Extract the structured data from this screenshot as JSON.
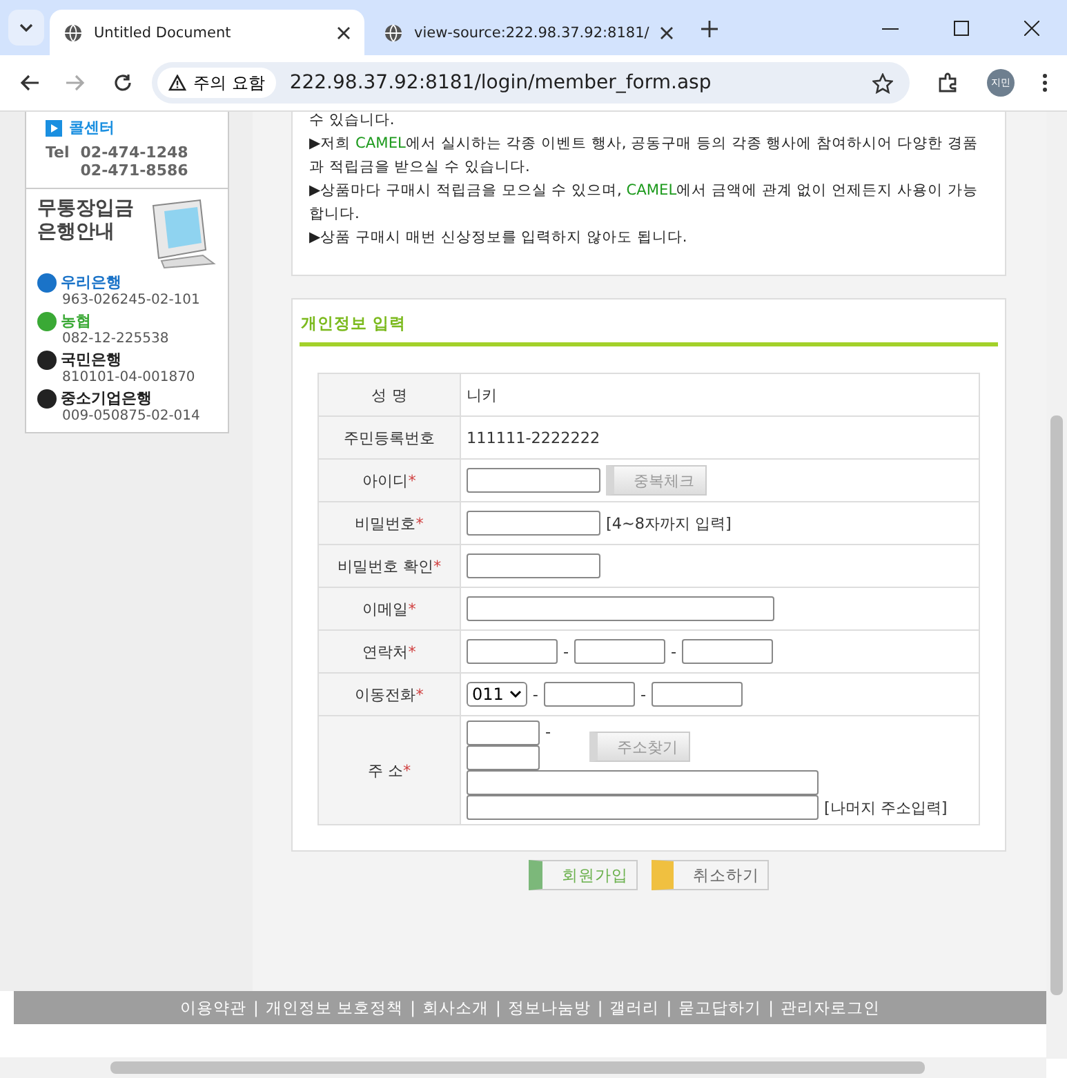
{
  "browser": {
    "tabs": [
      {
        "title": "Untitled Document",
        "selected": true
      },
      {
        "title": "view-source:222.98.37.92:8181/",
        "selected": false
      }
    ],
    "address": {
      "warning": "주의 요함",
      "url": "222.98.37.92:8181/login/member_form.asp"
    },
    "profile": "지민"
  },
  "sidebar": {
    "call_center": {
      "label": "콜센터",
      "tel_label": "Tel",
      "numbers": [
        "02-474-1248",
        "02-471-8586"
      ]
    },
    "bank_info": {
      "title_lines": [
        "무통장입금",
        "은행안내"
      ],
      "banks": [
        {
          "name": "우리은행",
          "account": "963-026245-02-101",
          "color": "#1a73c8"
        },
        {
          "name": "농협",
          "account": "082-12-225538",
          "color": "#3aa935"
        },
        {
          "name": "국민은행",
          "account": "810101-04-001870",
          "color": "#222222"
        },
        {
          "name": "중소기업은행",
          "account": "009-050875-02-014",
          "color": "#222222"
        }
      ]
    }
  },
  "benefits": [
    {
      "kind": "continuation",
      "parts": [
        {
          "text": "수 있습니다.",
          "brand": false
        }
      ]
    },
    {
      "kind": "bullet",
      "marker": "▶",
      "parts": [
        {
          "text": "저희 ",
          "brand": false
        },
        {
          "text": "CAMEL",
          "brand": true
        },
        {
          "text": "에서 실시하는 각종 이벤트 행사, 공동구매 등의 각종 행사에 참여하시어 다양한 경품과 적립금을 받으실 수 있습니다.",
          "brand": false
        }
      ]
    },
    {
      "kind": "bullet",
      "marker": "▶",
      "parts": [
        {
          "text": "상품마다 구매시 적립금을 모으실 수 있으며, ",
          "brand": false
        },
        {
          "text": "CAMEL",
          "brand": true
        },
        {
          "text": "에서 금액에 관계 없이 언제든지 사용이 가능합니다.",
          "brand": false
        }
      ]
    },
    {
      "kind": "bullet",
      "marker": "▶",
      "parts": [
        {
          "text": "상품 구매시 매번 신상정보를 입력하지 않아도 됩니다.",
          "brand": false
        }
      ]
    }
  ],
  "form": {
    "title": "개인정보 입력",
    "rows": [
      {
        "label": "성 명",
        "required": false,
        "kind": "text",
        "value": "니키"
      },
      {
        "label": "주민등록번호",
        "required": false,
        "kind": "text",
        "value": "111111-2222222"
      },
      {
        "label": "아이디",
        "required": true,
        "kind": "id",
        "button": "중복체크"
      },
      {
        "label": "비밀번호",
        "required": true,
        "kind": "password",
        "hint": "[4~8자까지 입력]"
      },
      {
        "label": "비밀번호 확인",
        "required": true,
        "kind": "password"
      },
      {
        "label": "이메일",
        "required": true,
        "kind": "email"
      },
      {
        "label": "연락처",
        "required": true,
        "kind": "phone",
        "separators": [
          "-",
          "-"
        ]
      },
      {
        "label": "이동전화",
        "required": true,
        "kind": "mobile",
        "prefix": "011",
        "separators": [
          "-",
          "-"
        ]
      },
      {
        "label": "주 소",
        "required": true,
        "kind": "address",
        "separator": "-",
        "button": "주소찾기",
        "hint": "[나머지 주소입력]"
      }
    ],
    "required_mark": "*"
  },
  "buttons": [
    {
      "label": "회원가입",
      "kind": "submit"
    },
    {
      "label": "취소하기",
      "kind": "cancel"
    }
  ],
  "footer": {
    "links": [
      "이용약관",
      "개인정보 보호정책",
      "회사소개",
      "정보나눔방",
      "갤러리",
      "묻고답하기",
      "관리자로그인"
    ],
    "separator": "|"
  }
}
